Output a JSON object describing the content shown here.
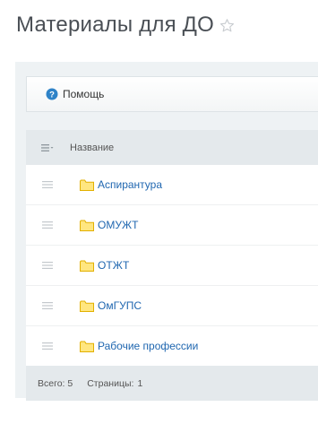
{
  "header": {
    "title": "Материалы для ДО"
  },
  "toolbar": {
    "help_label": "Помощь"
  },
  "grid": {
    "column_name": "Название",
    "rows": [
      {
        "label": "Аспирантура"
      },
      {
        "label": "ОМУЖТ"
      },
      {
        "label": "ОТЖТ"
      },
      {
        "label": "ОмГУПС"
      },
      {
        "label": "Рабочие профессии"
      }
    ],
    "footer": {
      "total_label": "Всего: 5",
      "pages_label": "Страницы:",
      "page_number": "1"
    }
  },
  "colors": {
    "link": "#2067b0",
    "folder": "#f7c600",
    "help_icon": "#2f83c8"
  }
}
